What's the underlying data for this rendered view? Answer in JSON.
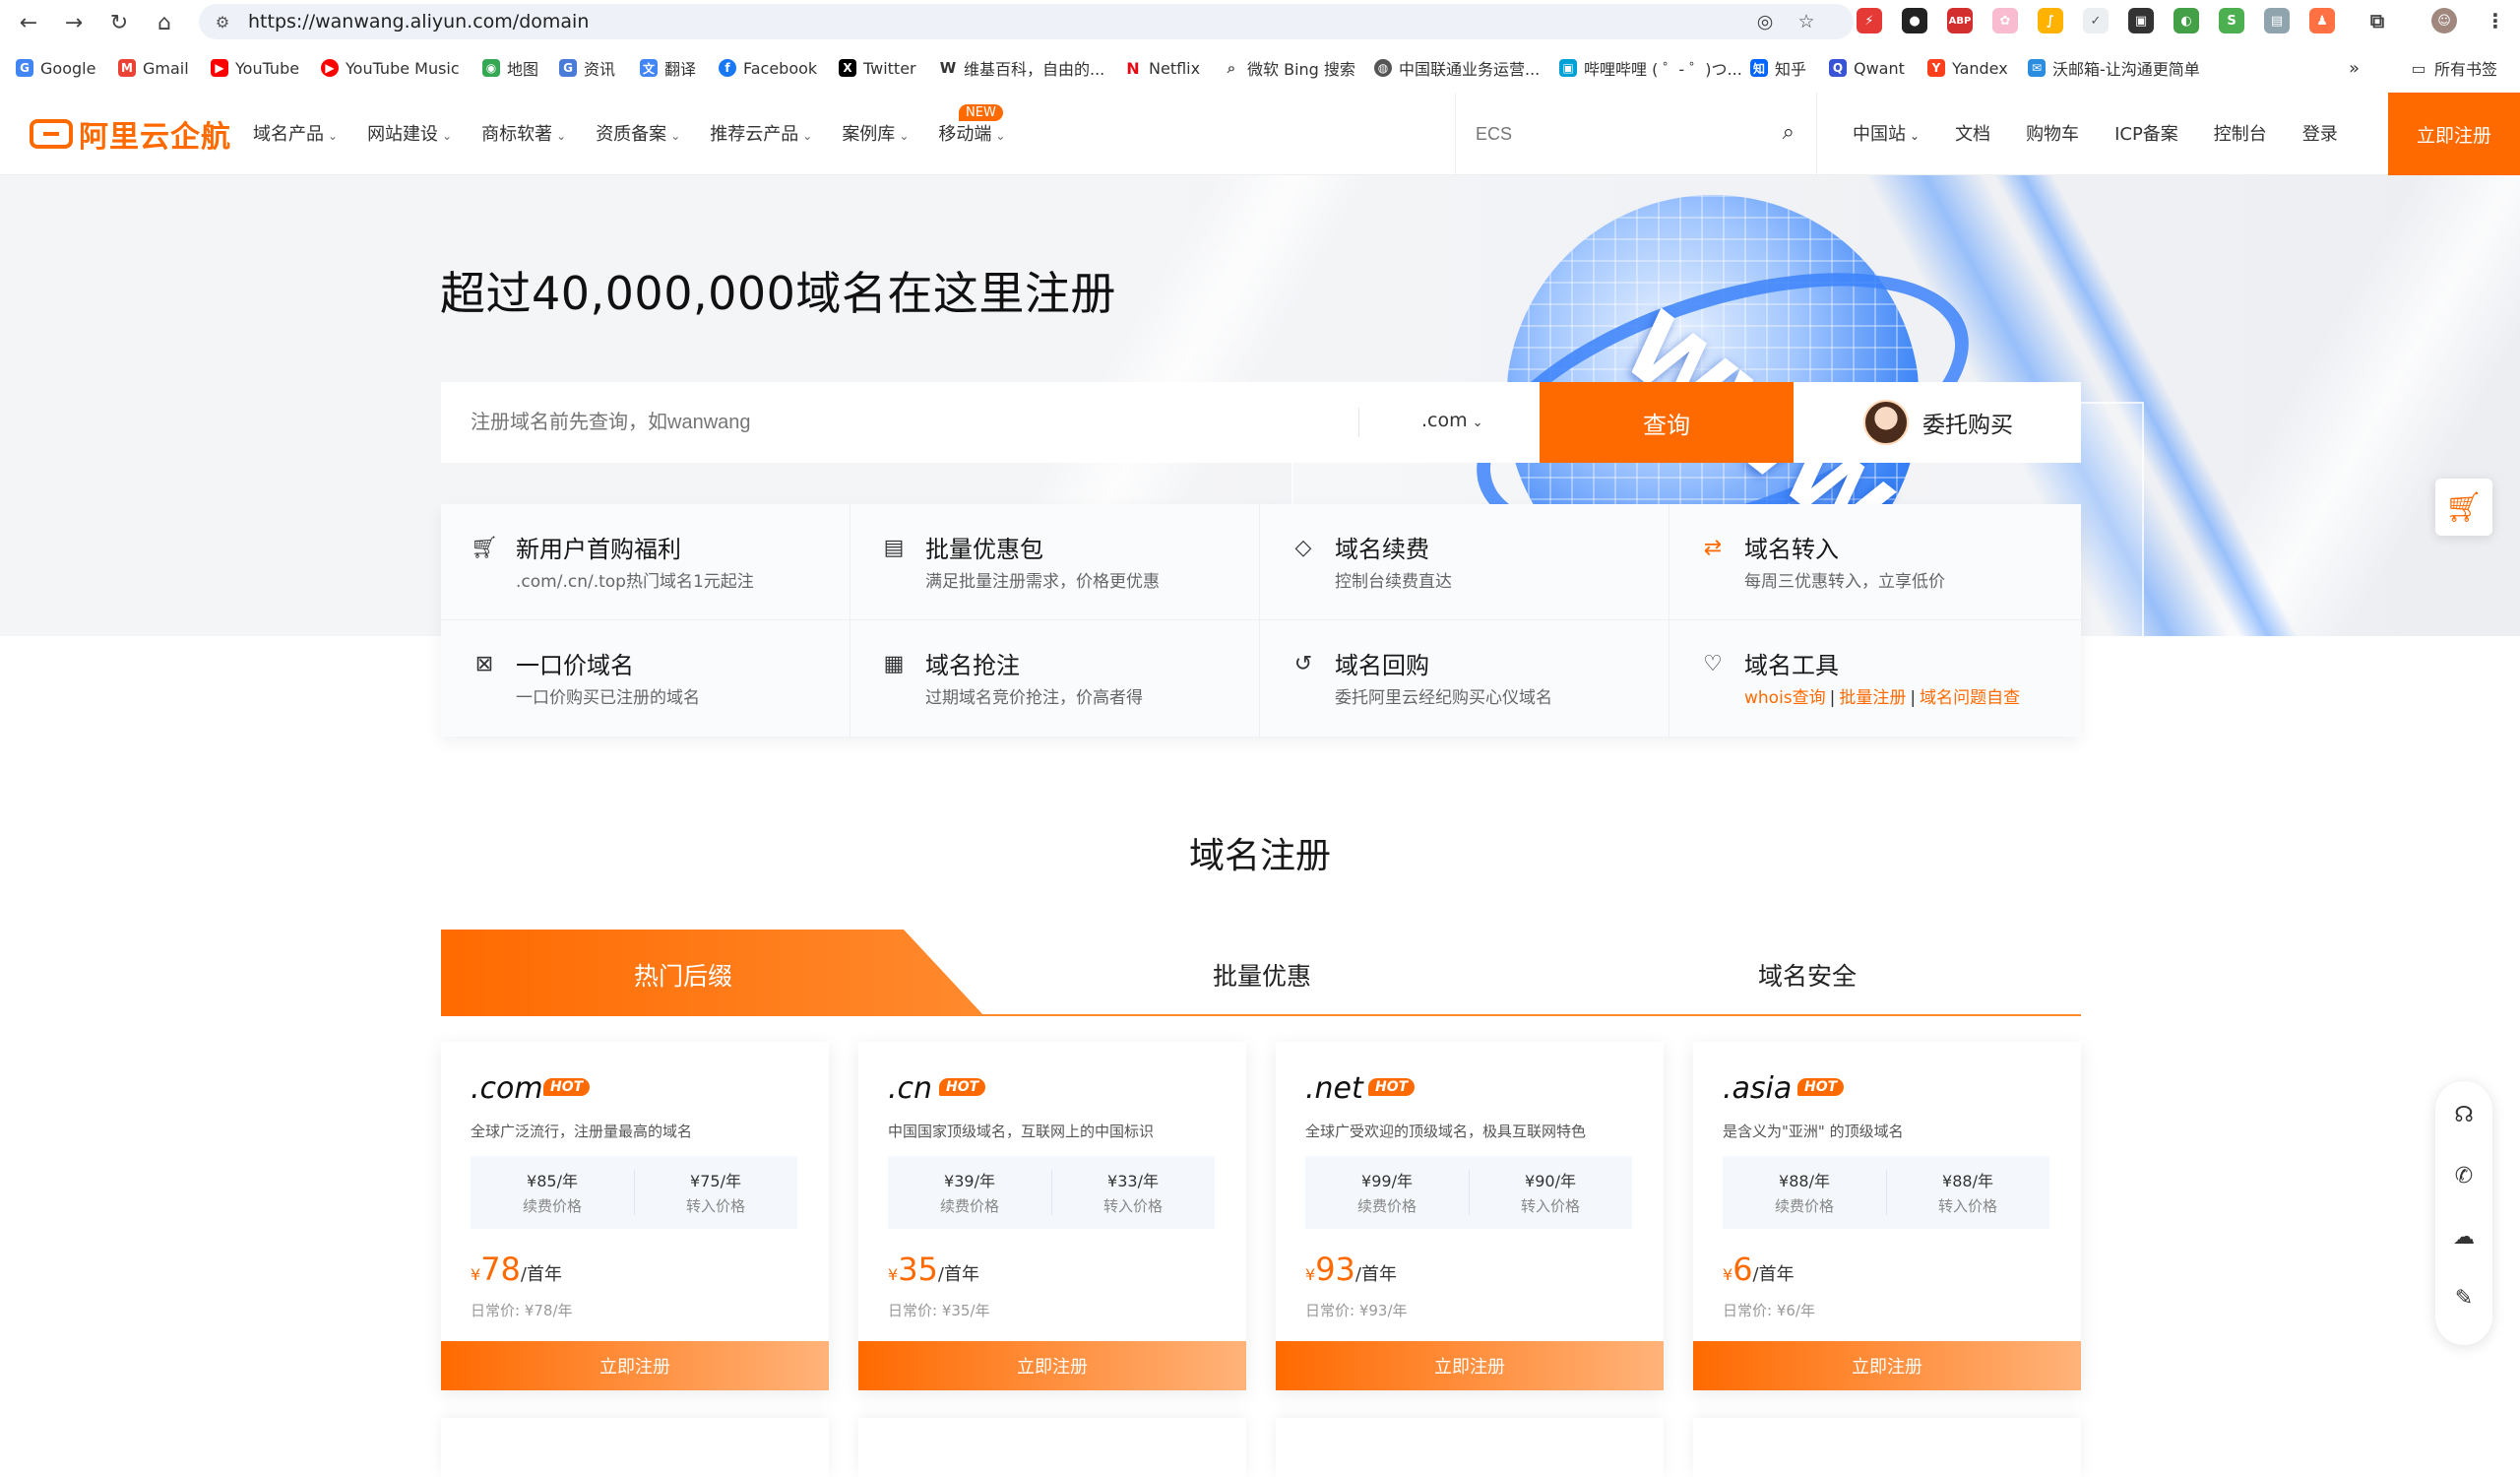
{
  "browser": {
    "url": "https://wanwang.aliyun.com/domain",
    "bookmarks": [
      {
        "label": "Google",
        "icon": "google-icon",
        "color": "#4285f4"
      },
      {
        "label": "Gmail",
        "icon": "gmail-icon",
        "color": "#ea4335"
      },
      {
        "label": "YouTube",
        "icon": "youtube-icon",
        "color": "#ff0000"
      },
      {
        "label": "YouTube Music",
        "icon": "youtube-music-icon",
        "color": "#ff0000"
      },
      {
        "label": "地图",
        "icon": "maps-icon",
        "color": "#34a853"
      },
      {
        "label": "资讯",
        "icon": "news-icon",
        "color": "#4a7bd9"
      },
      {
        "label": "翻译",
        "icon": "translate-icon",
        "color": "#4285f4"
      },
      {
        "label": "Facebook",
        "icon": "facebook-icon",
        "color": "#1877f2"
      },
      {
        "label": "Twitter",
        "icon": "x-icon",
        "color": "#000000"
      },
      {
        "label": "维基百科，自由的...",
        "icon": "wikipedia-icon",
        "color": "#333333"
      },
      {
        "label": "Netflix",
        "icon": "netflix-icon",
        "color": "#e50914"
      },
      {
        "label": "微软 Bing 搜索",
        "icon": "bing-search-icon",
        "color": "#555555"
      },
      {
        "label": "中国联通业务运营...",
        "icon": "globe-icon",
        "color": "#555555"
      },
      {
        "label": "哔哩哔哩 ( ゜- ゜)つ...",
        "icon": "bilibili-icon",
        "color": "#00a1d6"
      },
      {
        "label": "知乎",
        "icon": "zhihu-icon",
        "color": "#0066ff"
      },
      {
        "label": "Qwant",
        "icon": "qwant-icon",
        "color": "#3853d6"
      },
      {
        "label": "Yandex",
        "icon": "yandex-icon",
        "color": "#fc3f1d"
      },
      {
        "label": "沃邮箱-让沟通更简单",
        "icon": "mail-icon",
        "color": "#2a8de0"
      }
    ],
    "all_bookmarks": "所有书签"
  },
  "header": {
    "logo": "阿里云企航",
    "nav": [
      "域名产品",
      "网站建设",
      "商标软著",
      "资质备案",
      "推荐云产品",
      "案例库",
      "移动端"
    ],
    "new_badge": "NEW",
    "search_placeholder": "ECS",
    "right_nav": [
      "中国站",
      "文档",
      "购物车",
      "ICP备案",
      "控制台",
      "登录"
    ],
    "register": "立即注册"
  },
  "hero": {
    "title": "超过40,000,000域名在这里注册",
    "search_placeholder": "注册域名前先查询，如wanwang",
    "tld": ".com",
    "query_button": "查询",
    "proxy_buy": "委托购买"
  },
  "services": [
    {
      "title": "新用户首购福利",
      "desc": ".com/.cn/.top热门域名1元起注",
      "icon": "cart-icon"
    },
    {
      "title": "批量优惠包",
      "desc": "满足批量注册需求，价格更优惠",
      "icon": "package-icon"
    },
    {
      "title": "域名续费",
      "desc": "控制台续费直达",
      "icon": "tag-icon"
    },
    {
      "title": "域名转入",
      "desc": "每周三优惠转入，立享低价",
      "icon": "transfer-icon"
    },
    {
      "title": "一口价域名",
      "desc": "一口价购买已注册的域名",
      "icon": "fixed-price-icon"
    },
    {
      "title": "域名抢注",
      "desc": "过期域名竞价抢注，价高者得",
      "icon": "auction-icon"
    },
    {
      "title": "域名回购",
      "desc": "委托阿里云经纪购买心仪域名",
      "icon": "buyback-icon"
    },
    {
      "title": "域名工具",
      "desc": "",
      "icon": "tools-icon",
      "links": [
        "whois查询",
        "批量注册",
        "域名问题自查"
      ]
    }
  ],
  "section": {
    "title": "域名注册",
    "tabs": [
      "热门后缀",
      "批量优惠",
      "域名安全"
    ]
  },
  "cards": [
    {
      "name": ".com",
      "hot": "HOT",
      "desc": "全球广泛流行，注册量最高的域名",
      "renew": "¥85/年",
      "renew_label": "续费价格",
      "transfer": "¥75/年",
      "transfer_label": "转入价格",
      "currency": "¥",
      "price": "78",
      "unit": "/首年",
      "orig": "日常价:  ¥78/年",
      "button": "立即注册"
    },
    {
      "name": ".cn",
      "hot": "HOT",
      "desc": "中国国家顶级域名，互联网上的中国标识",
      "renew": "¥39/年",
      "renew_label": "续费价格",
      "transfer": "¥33/年",
      "transfer_label": "转入价格",
      "currency": "¥",
      "price": "35",
      "unit": "/首年",
      "orig": "日常价:  ¥35/年",
      "button": "立即注册"
    },
    {
      "name": ".net",
      "hot": "HOT",
      "desc": "全球广受欢迎的顶级域名，极具互联网特色",
      "renew": "¥99/年",
      "renew_label": "续费价格",
      "transfer": "¥90/年",
      "transfer_label": "转入价格",
      "currency": "¥",
      "price": "93",
      "unit": "/首年",
      "orig": "日常价:  ¥93/年",
      "button": "立即注册"
    },
    {
      "name": ".asia",
      "hot": "HOT",
      "desc": "是含义为\"亚洲\" 的顶级域名",
      "renew": "¥88/年",
      "renew_label": "续费价格",
      "transfer": "¥88/年",
      "transfer_label": "转入价格",
      "currency": "¥",
      "price": "6",
      "unit": "/首年",
      "orig": "日常价:  ¥6/年",
      "button": "立即注册"
    }
  ],
  "colors": {
    "brand": "#ff6a00",
    "accent_blue": "#2f7cf6"
  }
}
